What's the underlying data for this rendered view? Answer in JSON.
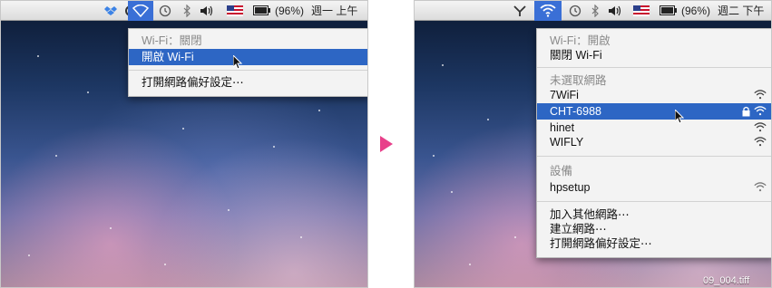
{
  "left": {
    "menubar": {
      "datetime": "週一 上午",
      "battery": "(96%)"
    },
    "menu": {
      "status": "Wi-Fi：關閉",
      "turn_on": "開啟 Wi-Fi",
      "open_prefs": "打開網路偏好設定⋯"
    }
  },
  "right": {
    "menubar": {
      "datetime": "週二 下午",
      "battery": "(96%)"
    },
    "menu": {
      "status": "Wi-Fi：開啟",
      "turn_off": "關閉 Wi-Fi",
      "networks_header": "未選取網路",
      "networks": [
        "7WiFi",
        "CHT-6988",
        "hinet",
        "WIFLY"
      ],
      "devices_header": "設備",
      "devices": [
        "hpsetup"
      ],
      "join_other": "加入其他網路⋯",
      "create_network": "建立網路⋯",
      "open_prefs": "打開網路偏好設定⋯"
    },
    "desktop_file": "09_004.tiff"
  },
  "colors": {
    "highlight": "#2d66c4",
    "arrow": "#e8408a"
  }
}
